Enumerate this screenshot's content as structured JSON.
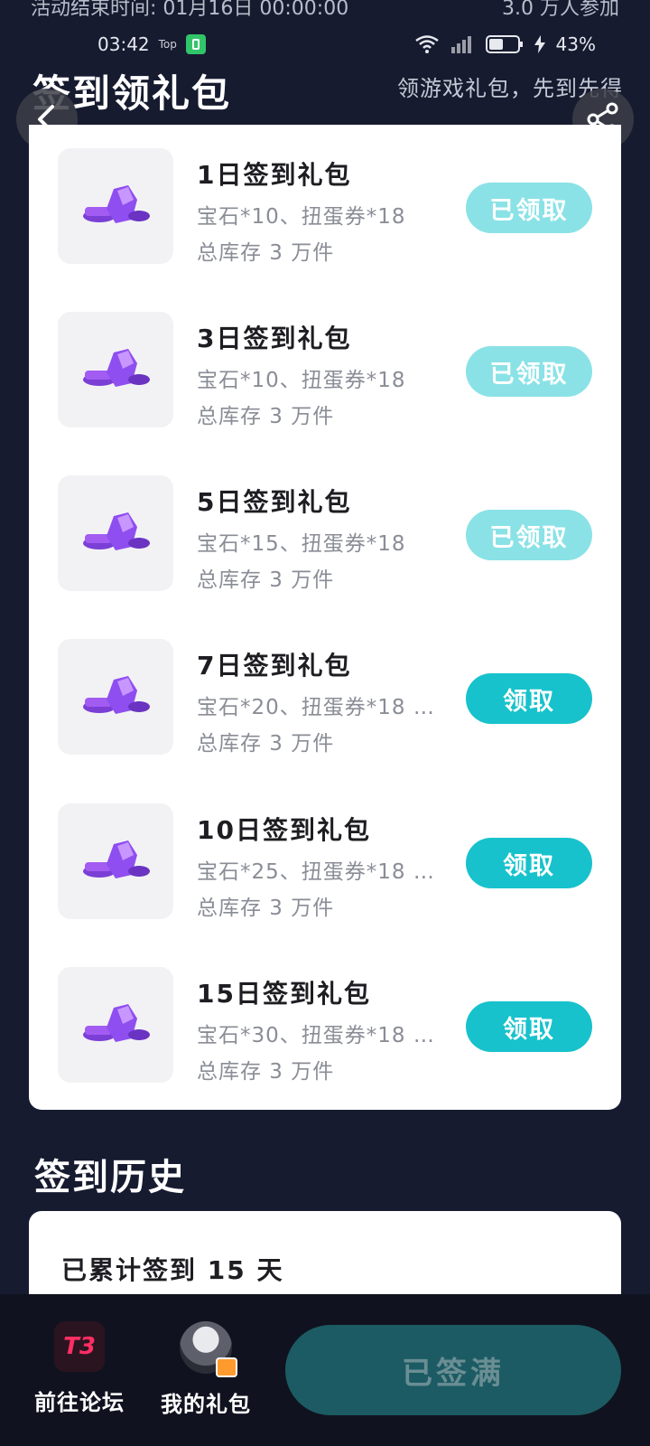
{
  "top_banner": {
    "end_time": "活动结束时间: 01月16日 00:00:00",
    "participants": "3.0 万人参加"
  },
  "status_bar": {
    "time": "03:42",
    "top_label": "Top",
    "battery": "43%"
  },
  "header": {
    "title": "签到领礼包",
    "subtitle": "领游戏礼包，先到先得"
  },
  "gifts": [
    {
      "name": "1日签到礼包",
      "content": "宝石*10、扭蛋券*18",
      "stock": "总库存 3 万件",
      "button": "已领取",
      "state": "claimed"
    },
    {
      "name": "3日签到礼包",
      "content": "宝石*10、扭蛋券*18",
      "stock": "总库存 3 万件",
      "button": "已领取",
      "state": "claimed"
    },
    {
      "name": "5日签到礼包",
      "content": "宝石*15、扭蛋券*18",
      "stock": "总库存 3 万件",
      "button": "已领取",
      "state": "claimed"
    },
    {
      "name": "7日签到礼包",
      "content": "宝石*20、扭蛋券*18 …",
      "stock": "总库存 3 万件",
      "button": "领取",
      "state": "available"
    },
    {
      "name": "10日签到礼包",
      "content": "宝石*25、扭蛋券*18 …",
      "stock": "总库存 3 万件",
      "button": "领取",
      "state": "available"
    },
    {
      "name": "15日签到礼包",
      "content": "宝石*30、扭蛋券*18 …",
      "stock": "总库存 3 万件",
      "button": "领取",
      "state": "available"
    }
  ],
  "history": {
    "title": "签到历史",
    "summary": "已累计签到 15 天"
  },
  "bottom_bar": {
    "forum_label": "前往论坛",
    "forum_logo": "T3",
    "my_gifts_label": "我的礼包",
    "main_button": "已签满"
  },
  "colors": {
    "background": "#171b30",
    "claimed_button": "#8ae2e6",
    "claim_button": "#17c2cc",
    "main_button": "#1c5b63"
  }
}
